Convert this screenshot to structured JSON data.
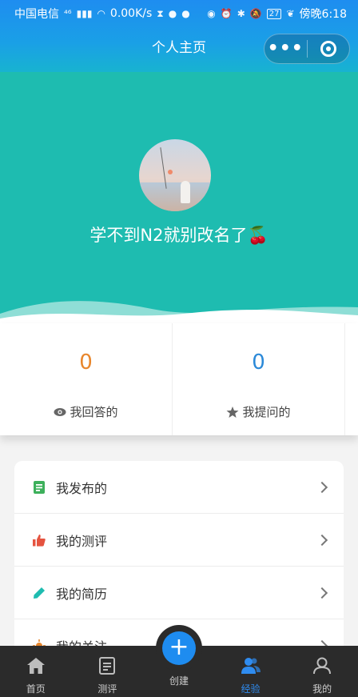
{
  "status_bar": {
    "carrier": "中国电信",
    "net": "⁴⁶",
    "speed": "0.00K/s",
    "battery": "27",
    "time": "傍晚6:18"
  },
  "nav": {
    "title": "个人主页",
    "more": "•••"
  },
  "profile": {
    "username": "学不到N2就别改名了🍒"
  },
  "stats": {
    "answered": {
      "count": "0",
      "label": "我回答的"
    },
    "asked": {
      "count": "0",
      "label": "我提问的"
    }
  },
  "menu": [
    {
      "label": "我发布的",
      "icon": "document-list-icon",
      "color": "#3db05b"
    },
    {
      "label": "我的测评",
      "icon": "thumbs-up-icon",
      "color": "#e5533f"
    },
    {
      "label": "我的简历",
      "icon": "pencil-icon",
      "color": "#1ebcb0"
    },
    {
      "label": "我的关注",
      "icon": "sun-icon",
      "color": "#e8862c"
    }
  ],
  "tabbar": [
    {
      "label": "首页",
      "icon": "home-icon"
    },
    {
      "label": "测评",
      "icon": "clipboard-icon"
    },
    {
      "label": "创建",
      "icon": "plus-icon"
    },
    {
      "label": "经验",
      "icon": "users-icon",
      "active": true
    },
    {
      "label": "我的",
      "icon": "user-icon"
    }
  ],
  "colors": {
    "accent": "#1ebcb0",
    "nav": "#1e8df0",
    "tab_active": "#2f8cf0"
  }
}
